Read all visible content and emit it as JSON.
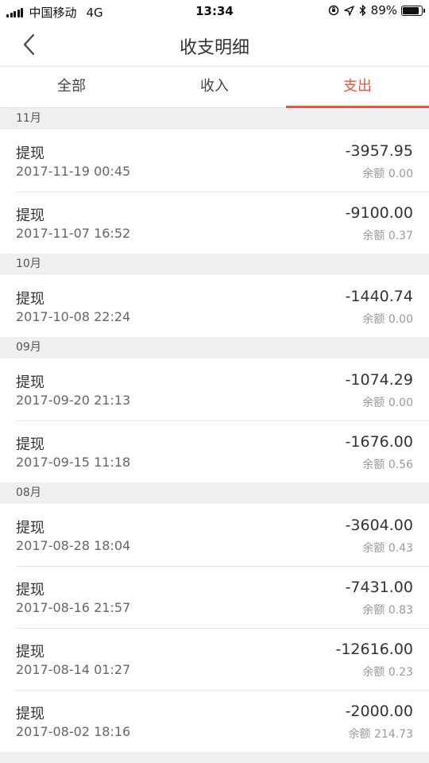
{
  "status_bar": {
    "carrier": "中国移动",
    "network": "4G",
    "time": "13:34",
    "battery": "89%"
  },
  "nav": {
    "title": "收支明细"
  },
  "tabs": [
    {
      "label": "全部",
      "active": false
    },
    {
      "label": "收入",
      "active": false
    },
    {
      "label": "支出",
      "active": true
    }
  ],
  "accent_color": "#f0533a",
  "groups": [
    {
      "month": "11月",
      "items": [
        {
          "title": "提现",
          "date": "2017-11-19 00:45",
          "amount": "-3957.95",
          "balance": "余额 0.00"
        },
        {
          "title": "提现",
          "date": "2017-11-07 16:52",
          "amount": "-9100.00",
          "balance": "余额 0.37"
        }
      ]
    },
    {
      "month": "10月",
      "items": [
        {
          "title": "提现",
          "date": "2017-10-08 22:24",
          "amount": "-1440.74",
          "balance": "余额 0.00"
        }
      ]
    },
    {
      "month": "09月",
      "items": [
        {
          "title": "提现",
          "date": "2017-09-20 21:13",
          "amount": "-1074.29",
          "balance": "余额 0.00"
        },
        {
          "title": "提现",
          "date": "2017-09-15 11:18",
          "amount": "-1676.00",
          "balance": "余额 0.56"
        }
      ]
    },
    {
      "month": "08月",
      "items": [
        {
          "title": "提现",
          "date": "2017-08-28 18:04",
          "amount": "-3604.00",
          "balance": "余额 0.43"
        },
        {
          "title": "提现",
          "date": "2017-08-16 21:57",
          "amount": "-7431.00",
          "balance": "余额 0.83"
        },
        {
          "title": "提现",
          "date": "2017-08-14 01:27",
          "amount": "-12616.00",
          "balance": "余额 0.23"
        },
        {
          "title": "提现",
          "date": "2017-08-02 18:16",
          "amount": "-2000.00",
          "balance": "余额 214.73"
        }
      ]
    }
  ]
}
